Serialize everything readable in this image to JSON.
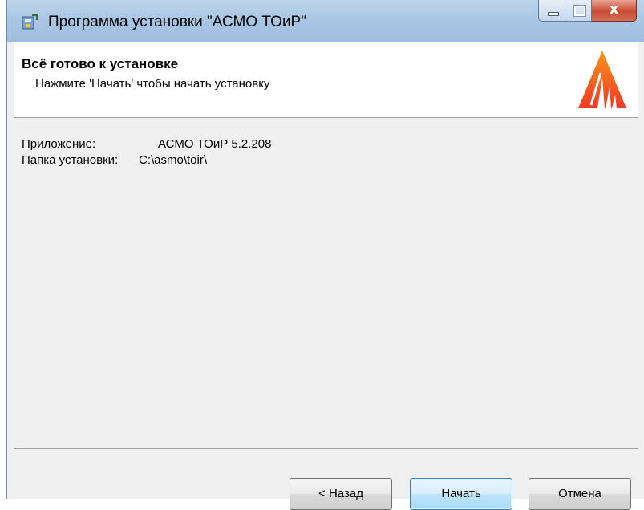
{
  "window": {
    "title": "Программа установки \"АСМО ТОиР\"",
    "close_glyph": "x"
  },
  "header": {
    "title": "Всё готово к установке",
    "subtitle": "Нажмите 'Начать' чтобы начать установку"
  },
  "info": {
    "app_label": "Приложение:",
    "app_value": "АСМО ТОиР 5.2.208",
    "folder_label": "Папка установки:",
    "folder_value": "C:\\asmo\\toir\\"
  },
  "buttons": {
    "back_label": "< Назад",
    "start_label": "Начать",
    "cancel_label": "Отмена"
  },
  "colors": {
    "logo_orange": "#f26522",
    "titlebar": "#a9c6e4",
    "close_red": "#c94a33"
  },
  "icons": {
    "app": "installer-icon",
    "logo": "asmo-logo-icon"
  }
}
